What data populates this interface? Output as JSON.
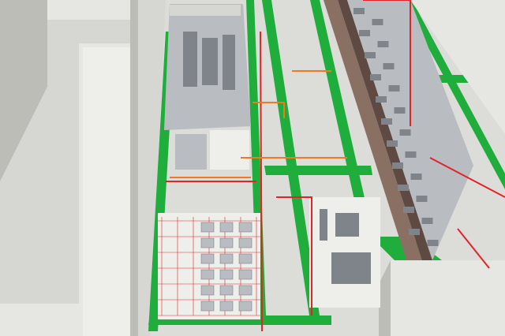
{
  "scene": {
    "kind": "isometric-factory-floor-render",
    "palette": {
      "floor": "#dcdcd8",
      "floor_light": "#eeeeeb",
      "wall": "#d6d6d2",
      "wall_shadow": "#bdbdb8",
      "roof": "#e6e6e3",
      "walkway": "#1fae3c",
      "walkway_dark": "#168a2e",
      "pipe_red": "#e0242a",
      "pipe_orange": "#f07a22",
      "equipment": "#b9bdc2",
      "equipment_dark": "#7e848a",
      "rack": "#8a6f63",
      "rack_dark": "#5e4a42"
    }
  }
}
